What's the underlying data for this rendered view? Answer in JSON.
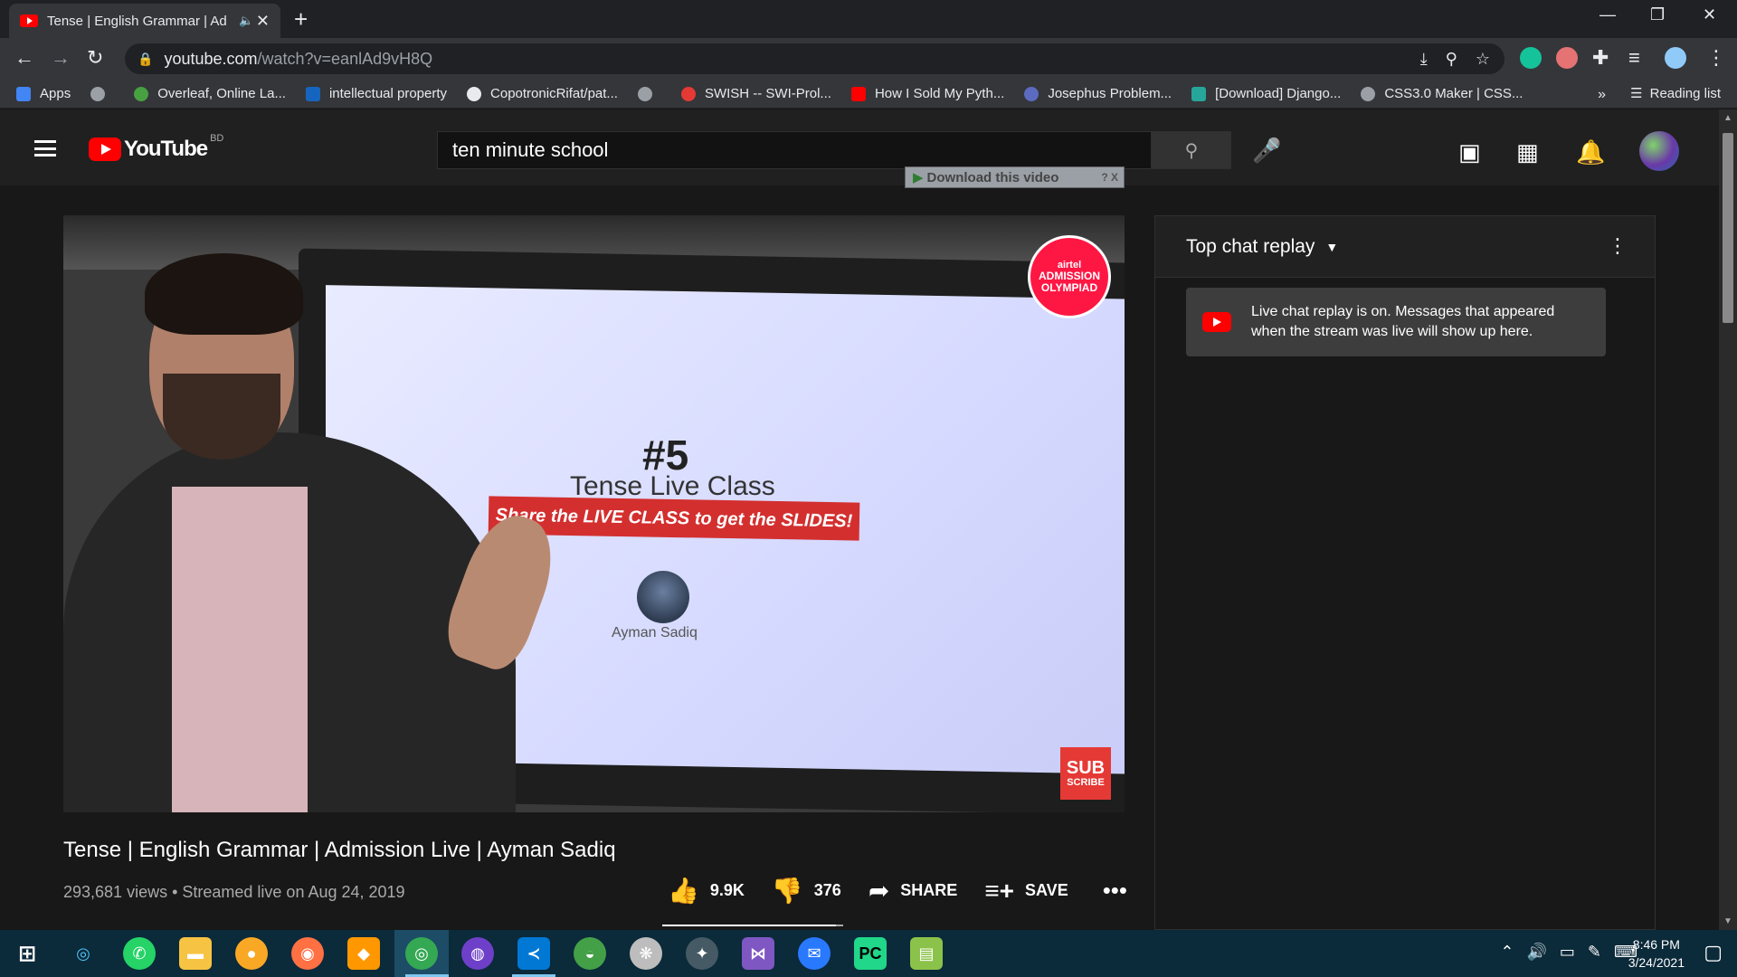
{
  "browser": {
    "tab_title": "Tense | English Grammar | Ad",
    "url_host": "youtube.com",
    "url_path": "/watch?v=eanlAd9vH8Q",
    "bookmarks": [
      {
        "label": "Apps",
        "color": "#4285f4"
      },
      {
        "label": "",
        "color": "#9aa0a6"
      },
      {
        "label": "Overleaf, Online La...",
        "color": "#47a141"
      },
      {
        "label": "intellectual property",
        "color": "#1565c0"
      },
      {
        "label": "CopotronicRifat/pat...",
        "color": "#e8eaed"
      },
      {
        "label": "",
        "color": "#9aa0a6"
      },
      {
        "label": "SWISH -- SWI-Prol...",
        "color": "#e53935"
      },
      {
        "label": "How I Sold My Pyth...",
        "color": "#ff0000"
      },
      {
        "label": "Josephus Problem...",
        "color": "#5c6bc0"
      },
      {
        "label": "[Download] Django...",
        "color": "#26a69a"
      },
      {
        "label": "CSS3.0 Maker | CSS...",
        "color": "#9aa0a6"
      }
    ],
    "more_bookmarks": "»",
    "reading_list": "Reading list"
  },
  "youtube": {
    "logo_text": "YouTube",
    "country": "BD",
    "search_query": "ten minute school",
    "download_bar": "Download this video",
    "download_help": "? X"
  },
  "video": {
    "slide_number": "#5",
    "slide_title": "Tense Live Class",
    "slide_banner": "Share the LIVE CLASS to get the SLIDES!",
    "slide_name": "Ayman Sadiq",
    "badge_top": "airtel",
    "badge_bottom": "ADMISSION OLYMPIAD",
    "subscribe_top": "SUB",
    "subscribe_bottom": "SCRIBE",
    "title": "Tense | English Grammar | Admission Live | Ayman Sadiq",
    "meta": "293,681 views • Streamed live on Aug 24, 2019",
    "likes": "9.9K",
    "dislikes": "376",
    "share": "SHARE",
    "save": "SAVE",
    "like_ratio": 0.96
  },
  "chat": {
    "title": "Top chat replay",
    "notice": "Live chat replay is on. Messages that appeared when the stream was live will show up here."
  },
  "taskbar": {
    "time": "8:46 PM",
    "date": "3/24/2021"
  },
  "colors": {
    "brand_red": "#ff0000",
    "background": "#181818",
    "masthead": "#202020",
    "taskbar": "#0b2a3a"
  }
}
